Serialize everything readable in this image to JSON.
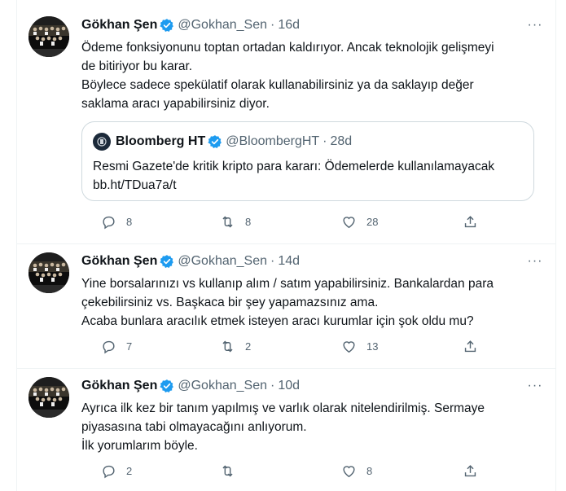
{
  "tweets": [
    {
      "author": {
        "name": "Gökhan Şen",
        "handle": "@Gokhan_Sen"
      },
      "separator": "·",
      "time": "16d",
      "body": [
        "Ödeme fonksiyonunu toptan ortadan kaldırıyor. Ancak teknolojik gelişmeyi",
        "de bitiriyor bu karar.",
        "Böylece sadece spekülatif olarak kullanabilirsiniz ya da saklayıp değer",
        "saklama aracı yapabilirsiniz diyor."
      ],
      "quote": {
        "author": {
          "name": "Bloomberg HT",
          "handle": "@BloombergHT"
        },
        "separator": "·",
        "time": "28d",
        "body": [
          "Resmi Gazete'de kritik kripto para kararı:  Ödemelerde kullanılamayacak",
          "bb.ht/TDua7a/t"
        ]
      },
      "stats": {
        "replies": "8",
        "retweets": "8",
        "likes": "28"
      }
    },
    {
      "author": {
        "name": "Gökhan Şen",
        "handle": "@Gokhan_Sen"
      },
      "separator": "·",
      "time": "14d",
      "body": [
        "Yine borsalarınızı vs kullanıp alım / satım yapabilirsiniz. Bankalardan para",
        "çekebilirsiniz vs. Başkaca bir şey yapamazsınız ama.",
        "Acaba bunlara aracılık etmek isteyen aracı kurumlar için şok oldu mu?"
      ],
      "stats": {
        "replies": "7",
        "retweets": "2",
        "likes": "13"
      }
    },
    {
      "author": {
        "name": "Gökhan Şen",
        "handle": "@Gokhan_Sen"
      },
      "separator": "·",
      "time": "10d",
      "body": [
        "Ayrıca ilk kez bir tanım yapılmış ve varlık olarak nitelendirilmiş. Sermaye",
        "piyasasına tabi olmayacağını anlıyorum.",
        "İlk yorumlarım böyle."
      ],
      "stats": {
        "replies": "2",
        "retweets": "",
        "likes": "8"
      }
    }
  ],
  "icons": {
    "verified": "verified-badge-icon",
    "more": "more-options-icon",
    "reply": "reply-icon",
    "retweet": "retweet-icon",
    "like": "heart-icon",
    "share": "share-icon"
  },
  "colors": {
    "text": "#0f1419",
    "secondary": "#536471",
    "verified": "#1d9bf0",
    "border": "#eff3f4",
    "quote_border": "#cfd9de"
  }
}
